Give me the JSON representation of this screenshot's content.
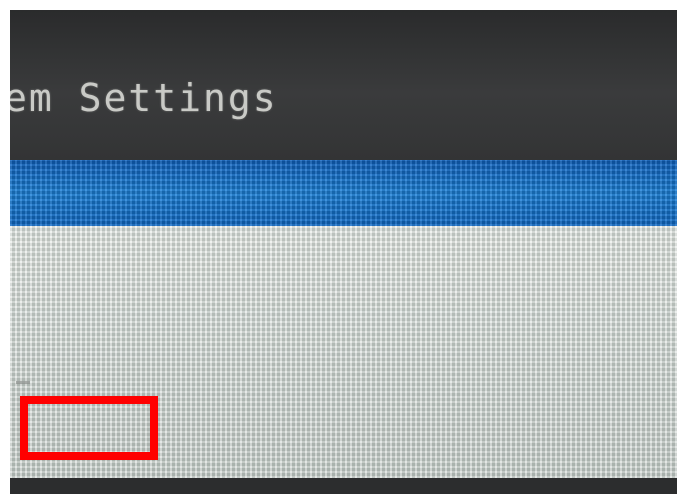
{
  "window": {
    "title": "em Settings"
  },
  "colors": {
    "title_bar": "#333435",
    "title_text": "#c9cac6",
    "selection_band": "#1577cf",
    "content_panel": "#d4dad6",
    "annotation_box": "#ff0000"
  }
}
